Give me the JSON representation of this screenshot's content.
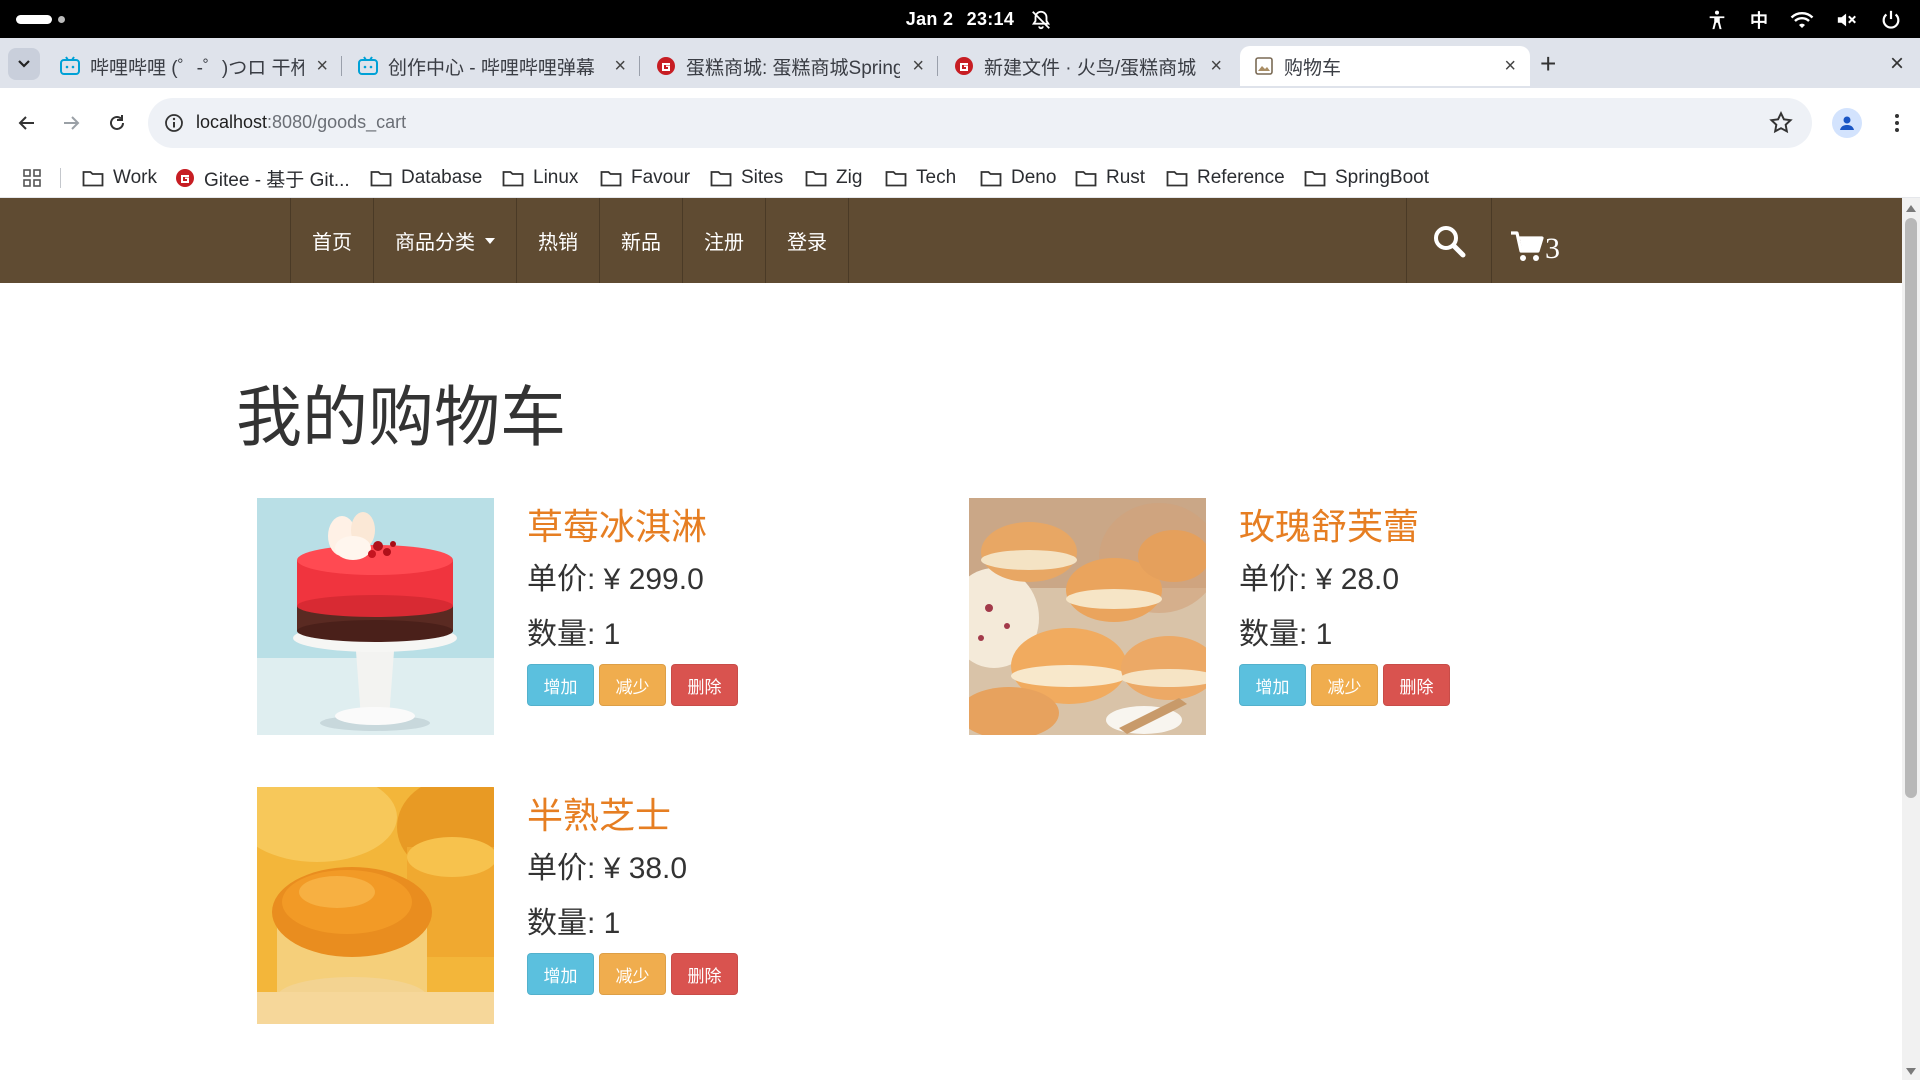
{
  "os": {
    "date": "Jan 2",
    "time": "23:14",
    "ime": "中"
  },
  "browser": {
    "tabs": [
      {
        "title": "哔哩哔哩 (゜-゜)つロ 干杯",
        "icon": "bilibili-icon",
        "active": false
      },
      {
        "title": "创作中心 - 哔哩哔哩弹幕",
        "icon": "bilibili-icon",
        "active": false
      },
      {
        "title": "蛋糕商城: 蛋糕商城Spring",
        "icon": "gitee-icon",
        "active": false
      },
      {
        "title": "新建文件 · 火鸟/蛋糕商城",
        "icon": "gitee-icon",
        "active": false
      },
      {
        "title": "购物车",
        "icon": "page-icon",
        "active": true
      }
    ],
    "new_tab_label": "+",
    "close_label": "×",
    "url_host": "localhost",
    "url_path": ":8080/goods_cart",
    "bookmarks": [
      "Work",
      "Gitee - 基于 Git...",
      "Database",
      "Linux",
      "Favour",
      "Sites",
      "Zig",
      "Tech",
      "Deno",
      "Rust",
      "Reference",
      "SpringBoot"
    ]
  },
  "nav": {
    "items": [
      "首页",
      "商品分类",
      "热销",
      "新品",
      "注册",
      "登录"
    ],
    "cart_count": "3"
  },
  "page": {
    "title": "我的购物车",
    "price_label": "单价: ",
    "qty_label": "数量: ",
    "add_label": "增加",
    "reduce_label": "减少",
    "delete_label": "删除",
    "items": [
      {
        "name": "草莓冰淇淋",
        "price": "¥ 299.0",
        "qty": "1",
        "image": "strawberry-cake"
      },
      {
        "name": "玫瑰舒芙蕾",
        "price": "¥ 28.0",
        "qty": "1",
        "image": "rose-souffle"
      },
      {
        "name": "半熟芝士",
        "price": "¥ 38.0",
        "qty": "1",
        "image": "half-cheese"
      }
    ]
  },
  "colors": {
    "nav_bg": "#5f4b32",
    "item_name": "#e67e22",
    "btn_add": "#5bc0de",
    "btn_reduce": "#f0ad4e",
    "btn_delete": "#d9534f"
  }
}
